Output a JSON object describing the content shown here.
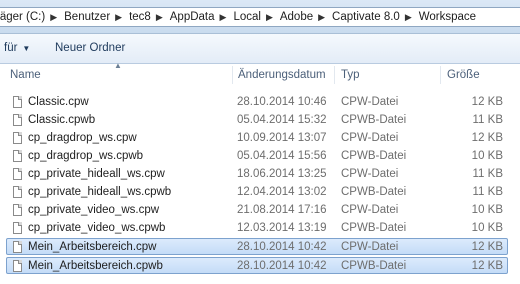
{
  "address": {
    "crumbs": [
      "räger (C:)",
      "Benutzer",
      "tec8",
      "AppData",
      "Local",
      "Adobe",
      "Captivate 8.0",
      "Workspace"
    ]
  },
  "toolbar": {
    "share_label": "für",
    "new_folder_label": "Neuer Ordner"
  },
  "columns": {
    "name": "Name",
    "date": "Änderungsdatum",
    "type": "Typ",
    "size": "Größe"
  },
  "files": [
    {
      "name": "Classic.cpw",
      "date": "28.10.2014 10:46",
      "type": "CPW-Datei",
      "size": "12 KB"
    },
    {
      "name": "Classic.cpwb",
      "date": "05.04.2014 15:32",
      "type": "CPWB-Datei",
      "size": "11 KB"
    },
    {
      "name": "cp_dragdrop_ws.cpw",
      "date": "10.09.2014 13:07",
      "type": "CPW-Datei",
      "size": "12 KB"
    },
    {
      "name": "cp_dragdrop_ws.cpwb",
      "date": "05.04.2014 15:56",
      "type": "CPWB-Datei",
      "size": "10 KB"
    },
    {
      "name": "cp_private_hideall_ws.cpw",
      "date": "18.06.2014 13:25",
      "type": "CPW-Datei",
      "size": "11 KB"
    },
    {
      "name": "cp_private_hideall_ws.cpwb",
      "date": "12.04.2014 13:02",
      "type": "CPWB-Datei",
      "size": "11 KB"
    },
    {
      "name": "cp_private_video_ws.cpw",
      "date": "21.08.2014 17:16",
      "type": "CPW-Datei",
      "size": "10 KB"
    },
    {
      "name": "cp_private_video_ws.cpwb",
      "date": "12.03.2014 13:19",
      "type": "CPWB-Datei",
      "size": "10 KB"
    },
    {
      "name": "Mein_Arbeitsbereich.cpw",
      "date": "28.10.2014 10:42",
      "type": "CPW-Datei",
      "size": "12 KB",
      "selected": true
    },
    {
      "name": "Mein_Arbeitsbereich.cpwb",
      "date": "28.10.2014 10:42",
      "type": "CPWB-Datei",
      "size": "12 KB",
      "selected": true
    }
  ],
  "icons": {
    "breadcrumb_separator": "chevron-right-icon",
    "dropdown": "chevron-down-icon",
    "file": "document-icon",
    "sort": "sort-up-icon"
  },
  "colors": {
    "selection_fill": "#cfe3fa",
    "selection_border": "#7da2ce",
    "toolbar_text": "#1e3a5c"
  }
}
